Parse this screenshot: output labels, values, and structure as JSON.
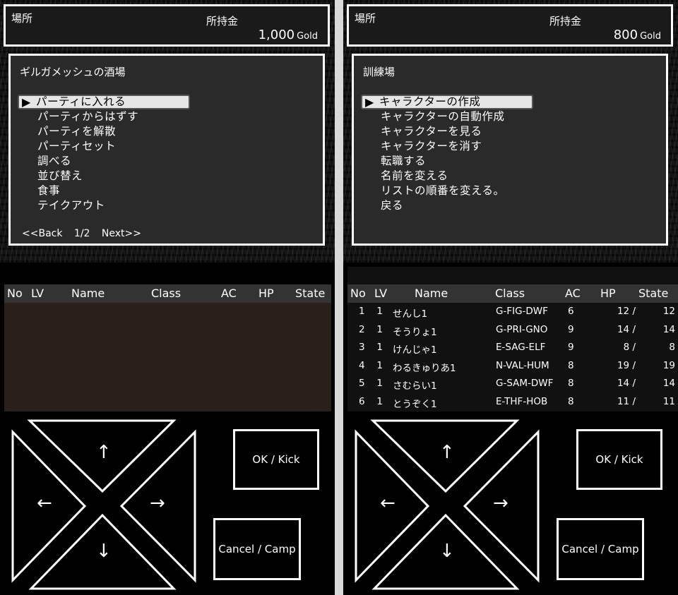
{
  "left": {
    "place_label": "場所",
    "money_label": "所持金",
    "money_value": "1,000",
    "money_unit": "Gold",
    "menu_title": "ギルガメッシュの酒場",
    "menu_items": [
      {
        "label": "パーティに入れる",
        "selected": true
      },
      {
        "label": "パーティからはずす"
      },
      {
        "label": "パーティを解散"
      },
      {
        "label": "パーティセット"
      },
      {
        "label": "調べる"
      },
      {
        "label": "並び替え"
      },
      {
        "label": "食事"
      },
      {
        "label": "テイクアウト"
      }
    ],
    "pager": {
      "back": "<<Back",
      "page": "1/2",
      "next": "Next>>"
    }
  },
  "right": {
    "place_label": "場所",
    "money_label": "所持金",
    "money_value": "800",
    "money_unit": "Gold",
    "menu_title": "訓練場",
    "menu_items": [
      {
        "label": "キャラクターの作成",
        "selected": true
      },
      {
        "label": "キャラクターの自動作成"
      },
      {
        "label": "キャラクターを見る"
      },
      {
        "label": "キャラクターを消す"
      },
      {
        "label": "転職する"
      },
      {
        "label": "名前を変える"
      },
      {
        "label": "リストの順番を変える。"
      },
      {
        "label": "戻る"
      }
    ]
  },
  "cursor_glyph": "▶",
  "table_headers": {
    "no": "No",
    "lv": "LV",
    "name": "Name",
    "class": "Class",
    "ac": "AC",
    "hp": "HP",
    "state": "State"
  },
  "roster": [
    {
      "no": "1",
      "lv": "1",
      "name": "せんし1",
      "class": "G-FIG-DWF",
      "ac": "6",
      "hp": "12 /",
      "hpmax": "12"
    },
    {
      "no": "2",
      "lv": "1",
      "name": "そうりょ1",
      "class": "G-PRI-GNO",
      "ac": "9",
      "hp": "14 /",
      "hpmax": "14"
    },
    {
      "no": "3",
      "lv": "1",
      "name": "けんじゃ1",
      "class": "E-SAG-ELF",
      "ac": "9",
      "hp": "8 /",
      "hpmax": "8"
    },
    {
      "no": "4",
      "lv": "1",
      "name": "わるきゅりあ1",
      "class": "N-VAL-HUM",
      "ac": "8",
      "hp": "19 /",
      "hpmax": "19"
    },
    {
      "no": "5",
      "lv": "1",
      "name": "さむらい1",
      "class": "G-SAM-DWF",
      "ac": "8",
      "hp": "14 /",
      "hpmax": "14"
    },
    {
      "no": "6",
      "lv": "1",
      "name": "とうぞく1",
      "class": "E-THF-HOB",
      "ac": "8",
      "hp": "11 /",
      "hpmax": "11"
    }
  ],
  "controls": {
    "ok_label": "OK / Kick",
    "cancel_label": "Cancel / Camp",
    "up": "↑",
    "down": "↓",
    "left": "←",
    "right": "→"
  },
  "colors": {
    "panel_bg": "#000000",
    "menu_bg": "#2a2a2a",
    "selected_bg": "#e6e6e6",
    "border": "#ffffff"
  }
}
